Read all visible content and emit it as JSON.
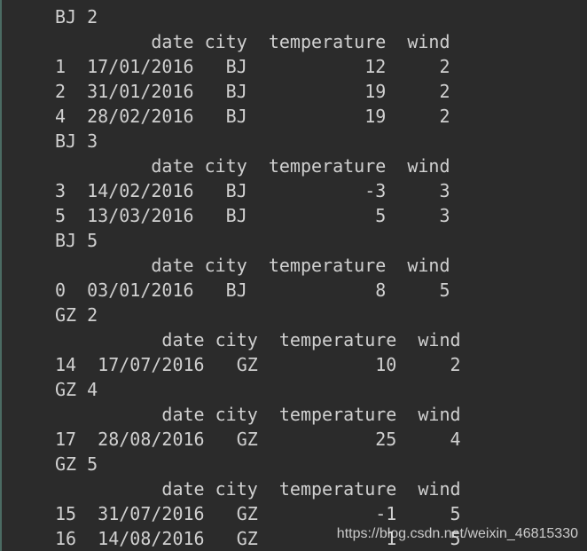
{
  "console_lines": [
    "BJ 2",
    "         date city  temperature  wind",
    "1  17/01/2016   BJ           12     2",
    "2  31/01/2016   BJ           19     2",
    "4  28/02/2016   BJ           19     2",
    "BJ 3",
    "         date city  temperature  wind",
    "3  14/02/2016   BJ           -3     3",
    "5  13/03/2016   BJ            5     3",
    "BJ 5",
    "         date city  temperature  wind",
    "0  03/01/2016   BJ            8     5",
    "GZ 2",
    "          date city  temperature  wind",
    "14  17/07/2016   GZ           10     2",
    "GZ 4",
    "          date city  temperature  wind",
    "17  28/08/2016   GZ           25     4",
    "GZ 5",
    "          date city  temperature  wind",
    "15  31/07/2016   GZ           -1     5",
    "16  14/08/2016   GZ            1     5"
  ],
  "watermark": "https://blog.csdn.net/weixin_46815330",
  "colors": {
    "background": "#2b2b2b",
    "text": "#d0d0d0"
  }
}
